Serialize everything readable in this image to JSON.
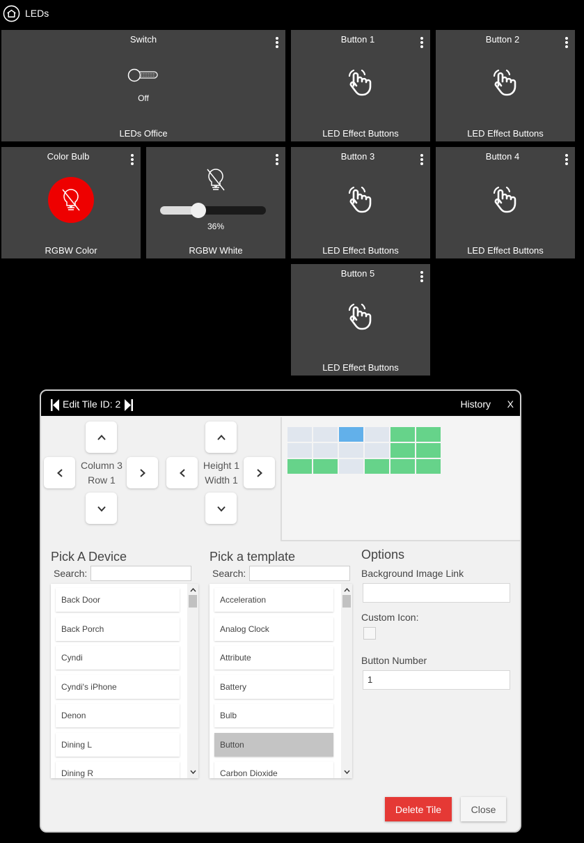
{
  "header": {
    "title": "LEDs",
    "icon": "home-icon"
  },
  "tiles": [
    {
      "title": "Switch",
      "footer": "LEDs Office",
      "state": "Off",
      "icon": "toggle-switch-icon"
    },
    {
      "title": "Button 1",
      "footer": "LED Effect Buttons",
      "icon": "pointing-hand-icon"
    },
    {
      "title": "Button 2",
      "footer": "LED Effect Buttons",
      "icon": "pointing-hand-icon"
    },
    {
      "title": "Color Bulb",
      "footer": "RGBW Color",
      "icon": "bulb-off-icon",
      "color": "#ee0000"
    },
    {
      "title": "",
      "footer": "RGBW White",
      "state": "36%",
      "level": 0.36,
      "icon": "bulb-off-icon"
    },
    {
      "title": "Button 3",
      "footer": "LED Effect Buttons",
      "icon": "pointing-hand-icon"
    },
    {
      "title": "Button 4",
      "footer": "LED Effect Buttons",
      "icon": "pointing-hand-icon"
    },
    {
      "title": "Button 5",
      "footer": "LED Effect Buttons",
      "icon": "pointing-hand-icon"
    }
  ],
  "dialog": {
    "title": "Edit Tile ID: 2",
    "history": "History",
    "close_x": "X",
    "position": {
      "column": "Column 3",
      "row": "Row 1"
    },
    "size": {
      "height": "Height 1",
      "width": "Width 1"
    },
    "grid_colors": {
      "empty": "#e0e6ee",
      "used": "#66d38a",
      "current": "#62b0ea"
    },
    "grid": [
      [
        "empty",
        "empty",
        "current",
        "empty",
        "used",
        "used"
      ],
      [
        "empty",
        "empty",
        "empty",
        "empty",
        "used",
        "used"
      ],
      [
        "used",
        "used",
        "empty",
        "used",
        "used",
        "used"
      ]
    ],
    "device_picker": {
      "title": "Pick A Device",
      "search_label": "Search:",
      "search_value": "",
      "items": [
        "Back Door",
        "Back Porch",
        "Cyndi",
        "Cyndi's iPhone",
        "Denon",
        "Dining L",
        "Dining R"
      ]
    },
    "template_picker": {
      "title": "Pick a template",
      "search_label": "Search:",
      "search_value": "",
      "items": [
        "Acceleration",
        "Analog Clock",
        "Attribute",
        "Battery",
        "Bulb",
        "Button",
        "Carbon Dioxide"
      ],
      "selected": "Button"
    },
    "options": {
      "title": "Options",
      "bg_image_label": "Background Image Link",
      "bg_image_value": "",
      "custom_icon_label": "Custom Icon:",
      "custom_icon_checked": false,
      "button_number_label": "Button Number",
      "button_number_value": "1"
    },
    "delete_label": "Delete Tile",
    "close_label": "Close",
    "colors": {
      "delete": "#e53935",
      "tile_bg": "#424242"
    }
  }
}
